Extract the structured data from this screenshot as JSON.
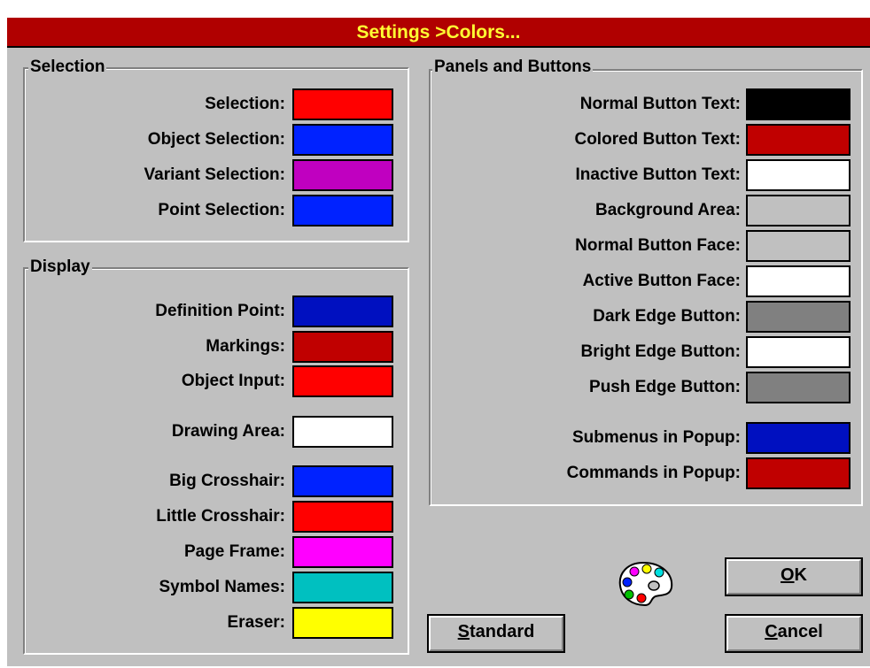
{
  "window": {
    "title": "Settings >Colors..."
  },
  "selection": {
    "legend": "Selection",
    "items": [
      {
        "label": "Selection:",
        "color": "#ff0000"
      },
      {
        "label": "Object Selection:",
        "color": "#0022ff"
      },
      {
        "label": "Variant Selection:",
        "color": "#c000c0"
      },
      {
        "label": "Point Selection:",
        "color": "#0022ff"
      }
    ]
  },
  "display": {
    "legend": "Display",
    "items": [
      {
        "label": "Definition Point:",
        "color": "#0010c0"
      },
      {
        "label": "Markings:",
        "color": "#c00000"
      },
      {
        "label": "Object Input:",
        "color": "#ff0000"
      },
      {
        "label": "Drawing Area:",
        "color": "#ffffff"
      },
      {
        "label": "Big Crosshair:",
        "color": "#0022ff"
      },
      {
        "label": "Little Crosshair:",
        "color": "#ff0000"
      },
      {
        "label": "Page Frame:",
        "color": "#ff00ff"
      },
      {
        "label": "Symbol Names:",
        "color": "#00c0c0"
      },
      {
        "label": "Eraser:",
        "color": "#ffff00"
      }
    ]
  },
  "panels": {
    "legend": "Panels and Buttons",
    "items": [
      {
        "label": "Normal Button Text:",
        "color": "#000000"
      },
      {
        "label": "Colored Button Text:",
        "color": "#c00000"
      },
      {
        "label": "Inactive Button Text:",
        "color": "#ffffff"
      },
      {
        "label": "Background Area:",
        "color": "#c0c0c0"
      },
      {
        "label": "Normal Button Face:",
        "color": "#c0c0c0"
      },
      {
        "label": "Active Button Face:",
        "color": "#ffffff"
      },
      {
        "label": "Dark Edge Button:",
        "color": "#808080"
      },
      {
        "label": "Bright Edge Button:",
        "color": "#ffffff"
      },
      {
        "label": "Push Edge Button:",
        "color": "#808080"
      },
      {
        "label": "Submenus in Popup:",
        "color": "#0010c0"
      },
      {
        "label": "Commands in Popup:",
        "color": "#c00000"
      }
    ]
  },
  "buttons": {
    "ok": {
      "mnemonic": "O",
      "rest": "K"
    },
    "cancel": {
      "mnemonic": "C",
      "rest": "ancel"
    },
    "standard": {
      "mnemonic": "S",
      "rest": "tandard"
    }
  },
  "icons": {
    "palette": "palette-icon"
  }
}
